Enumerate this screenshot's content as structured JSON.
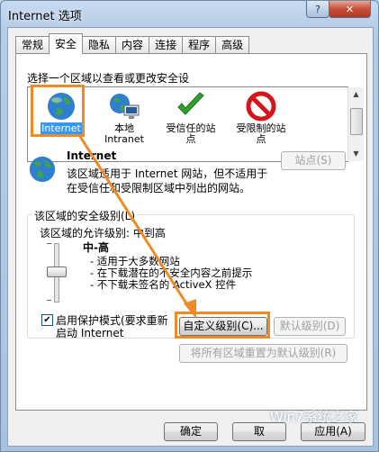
{
  "window": {
    "title": "Internet 选项",
    "help": "?",
    "close": "✕"
  },
  "tabs": [
    "常规",
    "安全",
    "隐私",
    "内容",
    "连接",
    "程序",
    "高级"
  ],
  "active_tab": "安全",
  "zone_prompt": "选择一个区域以查看或更改安全设",
  "zones": [
    {
      "label": "Internet",
      "icon": "globe-icon",
      "selected": true
    },
    {
      "label": "本地\nIntranet",
      "icon": "intranet-icon",
      "selected": false
    },
    {
      "label": "受信任的站\n点",
      "icon": "check-icon",
      "selected": false
    },
    {
      "label": "受限制的站\n点",
      "icon": "no-entry-icon",
      "selected": false
    }
  ],
  "zone_detail": {
    "name": "Internet",
    "description_line1": "该区域适用于 Internet 网站，但不适用于",
    "description_line2": "在受信任和受限制区域中列出的网站。",
    "sites_button": "站点(S)"
  },
  "security_level": {
    "group_title": "该区域的安全级别(L)",
    "allowed_levels": "该区域的允许级别: 中到高",
    "level_name": "中-高",
    "bullets": [
      "- 适用于大多数网站",
      "- 在下载潜在的不安全内容之前提示",
      "- 不下载未签名的 ActiveX 控件"
    ],
    "protected_mode_line1": "启用保护模式(要求重新",
    "protected_mode_line2": "启动 Internet",
    "protected_mode_checked": true,
    "custom_level_button": "自定义级别(C)...",
    "default_level_button": "默认级别(D)",
    "reset_all_button": "将所有区域重置为默认级别(R)"
  },
  "footer": {
    "ok": "确定",
    "cancel": "取",
    "apply": "应用(A)"
  },
  "watermark": "Win7系统之家",
  "colors": {
    "highlight_orange": "#f08a24",
    "selection_blue": "#3399ff"
  }
}
